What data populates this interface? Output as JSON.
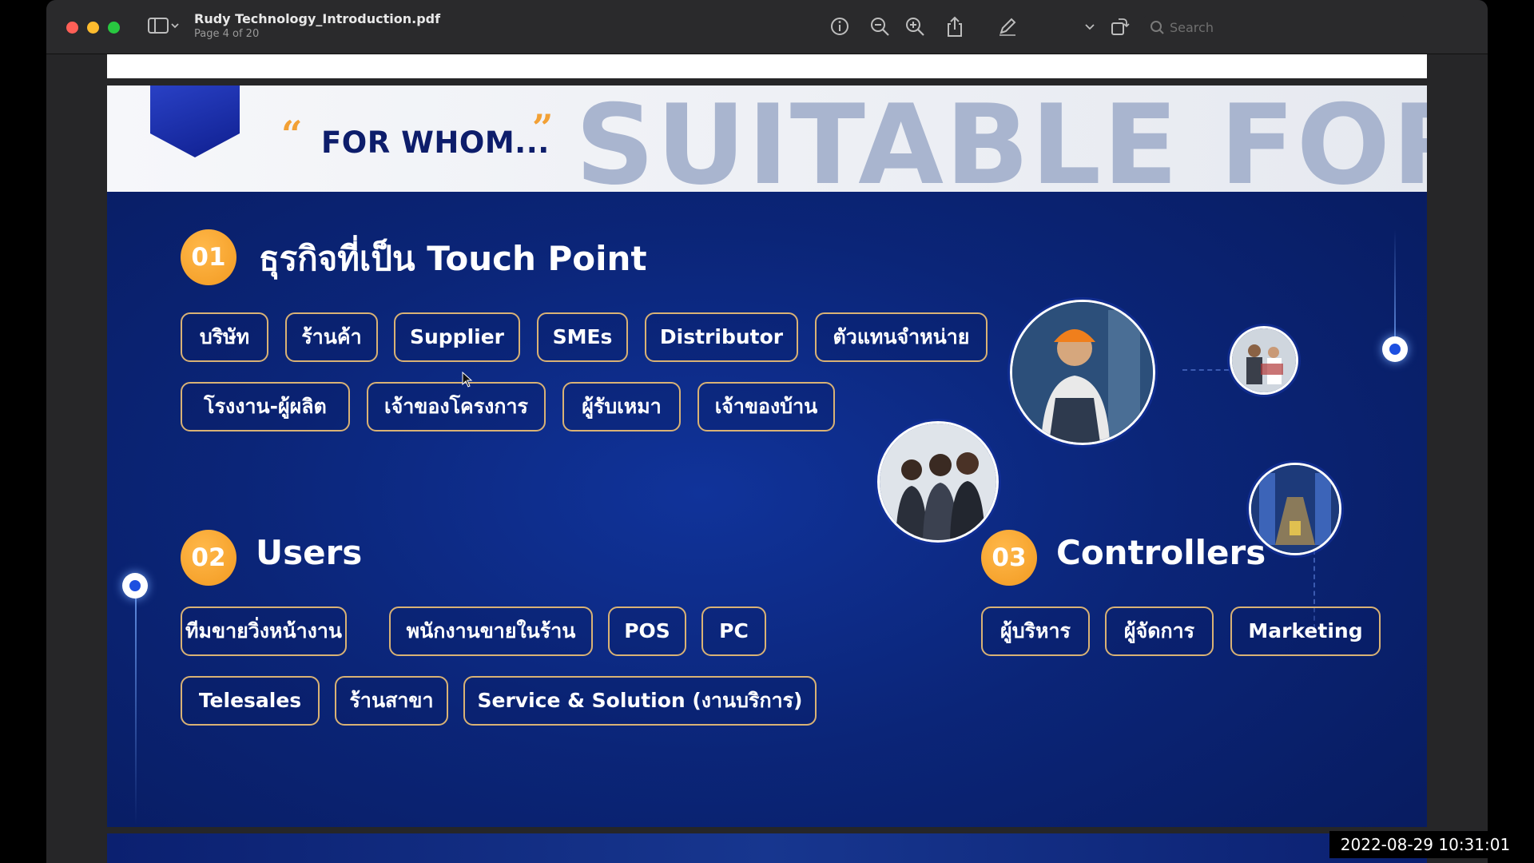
{
  "window": {
    "title": "Rudy Technology_Introduction.pdf",
    "page_indicator": "Page 4 of 20",
    "search_placeholder": "Search"
  },
  "toolbar_icons": [
    "sidebar-icon",
    "info-icon",
    "zoom-out-icon",
    "zoom-in-icon",
    "share-icon",
    "markup-pen-icon",
    "chevron-down-icon",
    "rotate-icon",
    "annotate-icon",
    "search-icon"
  ],
  "slide": {
    "header": {
      "quote_open": "“",
      "tagline": "FOR WHOM...",
      "quote_close": "”",
      "headline": "SUITABLE FOR"
    },
    "sections": [
      {
        "number": "01",
        "title": "ธุรกิจที่เป็น Touch Point",
        "tags": [
          "บริษัท",
          "ร้านค้า",
          "Supplier",
          "SMEs",
          "Distributor",
          "ตัวแทนจำหน่าย",
          "โรงงาน-ผู้ผลิต",
          "เจ้าของโครงการ",
          "ผู้รับเหมา",
          "เจ้าของบ้าน"
        ]
      },
      {
        "number": "02",
        "title": "Users",
        "tags": [
          "ทีมขายวิ่งหน้างาน",
          "พนักงานขายในร้าน",
          "POS",
          "PC",
          "Telesales",
          "ร้านสาขา",
          "Service & Solution (งานบริการ)"
        ]
      },
      {
        "number": "03",
        "title": "Controllers",
        "tags": [
          "ผู้บริหาร",
          "ผู้จัดการ",
          "Marketing"
        ]
      }
    ]
  },
  "overlay": {
    "timestamp": "2022-08-29 10:31:01"
  },
  "colors": {
    "slide_background": "#0b2578",
    "accent_orange": "#f29a21",
    "tag_border": "#d9b275",
    "header_text": "#0d1d6b",
    "headline_gray": "#a9b5cf"
  }
}
